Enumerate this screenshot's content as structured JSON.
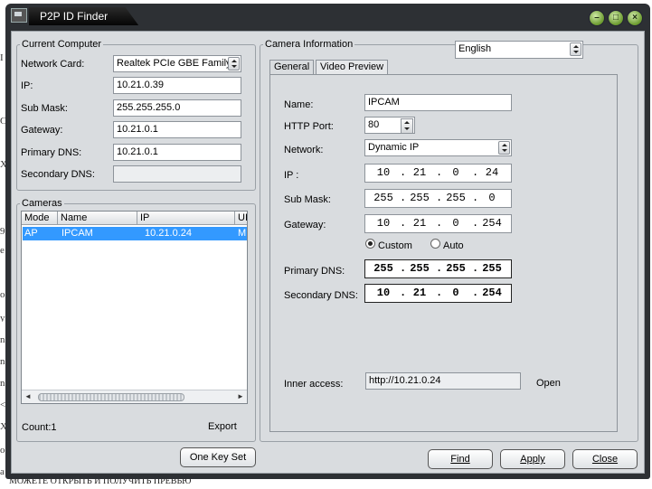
{
  "window": {
    "title": "P2P ID Finder"
  },
  "background": {
    "edge_chars": [
      "I",
      "C",
      "X",
      "9",
      "e",
      "o",
      "y",
      "n",
      "n",
      "n",
      "<",
      "X",
      "o",
      "a"
    ],
    "bottom_text": "МОЖЕТЕ ОТКРЫТЬ И ПОЛУЧИТЬ ПРЕВЬЮ"
  },
  "current_computer": {
    "legend": "Current Computer",
    "network_card_label": "Network Card:",
    "network_card_value": "Realtek PCIe GBE Family",
    "ip_label": "IP:",
    "ip_value": "10.21.0.39",
    "submask_label": "Sub Mask:",
    "submask_value": "255.255.255.0",
    "gateway_label": "Gateway:",
    "gateway_value": "10.21.0.1",
    "primary_dns_label": "Primary DNS:",
    "primary_dns_value": "10.21.0.1",
    "secondary_dns_label": "Secondary DNS:",
    "secondary_dns_value": ""
  },
  "cameras": {
    "legend": "Cameras",
    "columns": [
      "Mode",
      "Name",
      "IP",
      "UI"
    ],
    "rows": [
      {
        "mode": "AP",
        "name": "IPCAM",
        "ip": "10.21.0.24",
        "ui": "MI"
      }
    ],
    "count_label": "Count:",
    "count_value": "1",
    "export_label": "Export"
  },
  "one_key_set_label": "One Key Set",
  "camera_info": {
    "legend": "Camera Information",
    "language": "English",
    "tabs": [
      "General",
      "Video Preview"
    ],
    "name_label": "Name:",
    "name_value": "IPCAM",
    "http_port_label": "HTTP Port:",
    "http_port_value": "80",
    "network_label": "Network:",
    "network_value": "Dynamic IP",
    "ip_label": "IP  :",
    "ip_octets": [
      "10",
      "21",
      "0",
      "24"
    ],
    "submask_label": "Sub Mask:",
    "submask_octets": [
      "255",
      "255",
      "255",
      "0"
    ],
    "gateway_label": "Gateway:",
    "gateway_octets": [
      "10",
      "21",
      "0",
      "254"
    ],
    "custom_label": "Custom",
    "auto_label": "Auto",
    "primary_dns_label": "Primary DNS:",
    "primary_dns_octets": [
      "255",
      "255",
      "255",
      "255"
    ],
    "secondary_dns_label": "Secondary DNS:",
    "secondary_dns_octets": [
      "10",
      "21",
      "0",
      "254"
    ],
    "inner_access_label": "Inner access:",
    "inner_access_value": "http://10.21.0.24",
    "open_label": "Open"
  },
  "buttons": {
    "find": "Find",
    "apply": "Apply",
    "close": "Close"
  }
}
